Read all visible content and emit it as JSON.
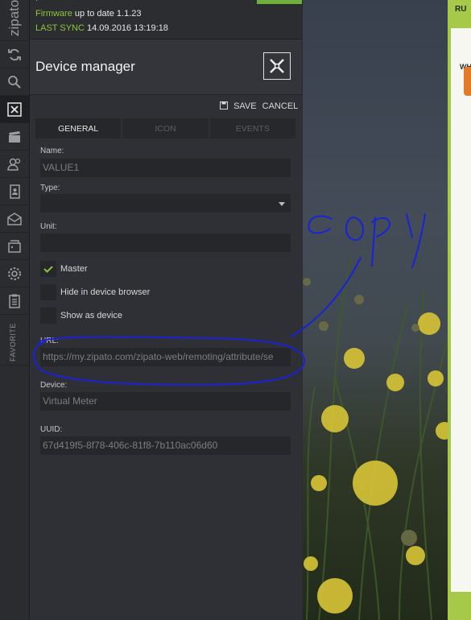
{
  "sidebar": {
    "brand": "zipato",
    "items": [
      {
        "name": "sync-icon"
      },
      {
        "name": "search-icon"
      },
      {
        "name": "device-manager-icon"
      },
      {
        "name": "scenes-icon"
      },
      {
        "name": "users-icon"
      },
      {
        "name": "contacts-icon"
      },
      {
        "name": "messages-icon"
      },
      {
        "name": "devices-icon"
      },
      {
        "name": "settings-icon"
      },
      {
        "name": "log-icon"
      }
    ],
    "favorite_label": "FAVORITE"
  },
  "status": {
    "firmware_label": "Firmware",
    "firmware_text": "up to date 1.1.23",
    "sync_label": "LAST SYNC",
    "sync_time": "14.09.2016 13:19:18"
  },
  "header": {
    "title": "Device manager",
    "icon": "device-manager-icon"
  },
  "actions": {
    "save_label": "SAVE",
    "cancel_label": "CANCEL"
  },
  "tabs": [
    {
      "label": "GENERAL",
      "active": true
    },
    {
      "label": "ICON",
      "active": false
    },
    {
      "label": "EVENTS",
      "active": false
    }
  ],
  "form": {
    "name_label": "Name:",
    "name_value": "VALUE1",
    "type_label": "Type:",
    "type_value": "",
    "unit_label": "Unit:",
    "unit_value": "",
    "master_label": "Master",
    "master_checked": true,
    "hide_label": "Hide in device browser",
    "hide_checked": false,
    "show_label": "Show as device",
    "show_checked": false,
    "url_label": "URL:",
    "url_value": "https://my.zipato.com/zipato-web/remoting/attribute/se",
    "device_label": "Device:",
    "device_value": "Virtual Meter",
    "uuid_label": "UUID:",
    "uuid_value": "67d419f5-8f78-406c-81f8-7b110ac06d60"
  },
  "annotation": {
    "text": "copy",
    "color": "#1a22d8"
  },
  "right_card": {
    "title": "RU",
    "subtitle": "WH"
  },
  "colors": {
    "accent_green": "#8cc63f",
    "card_green": "#a6c94a"
  }
}
